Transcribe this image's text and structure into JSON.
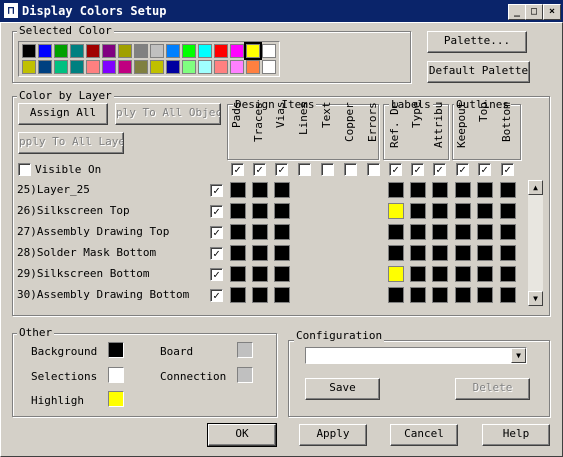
{
  "window": {
    "title": "Display Colors Setup",
    "buttons": [
      "_",
      "□",
      "×"
    ]
  },
  "selected_color": {
    "label": "Selected Color",
    "row1": [
      "#000000",
      "#0000ff",
      "#00a000",
      "#008080",
      "#a00000",
      "#800080",
      "#a0a000",
      "#808080",
      "#c0c0c0",
      "#0080ff",
      "#00ff00",
      "#00ffff",
      "#ff0000",
      "#ff00ff",
      "#ffff00",
      "#ffffff"
    ],
    "row2": [
      "#c0c000",
      "#004080",
      "#00c080",
      "#008080",
      "#ff8080",
      "#8000ff",
      "#c00080",
      "#808040",
      "#c0c000",
      "#0000a0",
      "#80ff80",
      "#a0ffff",
      "#ff8080",
      "#ff80ff",
      "#ff8040",
      "#ffffff"
    ],
    "selected_index": 14
  },
  "palette_button": "Palette...",
  "default_palette_button": "Default Palette",
  "color_by_layer": {
    "label": "Color by Layer",
    "assign_all": "Assign All",
    "apply_to_all_objects": "ply To All Objec",
    "apply_to_all_layers": "pply To All Layer",
    "design_items_label": "Design Items",
    "labels_label": "Labels",
    "outlines_label": "Outlines",
    "columns": [
      "Pads",
      "Traces",
      "Vias",
      "Lines",
      "Text",
      "Copper",
      "Errors",
      "Ref. De",
      "Type",
      "Attribu",
      "Keepout",
      "Top",
      "Bottom"
    ],
    "visible_on_label": "Visible On",
    "column_visible": [
      true,
      true,
      true,
      false,
      false,
      false,
      false,
      true,
      true,
      true,
      true,
      true,
      true
    ],
    "layers": [
      {
        "name": "25)Layer_25",
        "checked": true,
        "colors": [
          "#000000",
          "#000000",
          "#000000",
          "",
          "",
          "",
          "",
          "#000000",
          "#000000",
          "#000000",
          "#000000",
          "#000000",
          "#000000"
        ]
      },
      {
        "name": "26)Silkscreen Top",
        "checked": true,
        "colors": [
          "#000000",
          "#000000",
          "#000000",
          "",
          "",
          "",
          "",
          "#ffff00",
          "#000000",
          "#000000",
          "#000000",
          "#000000",
          "#000000"
        ]
      },
      {
        "name": "27)Assembly Drawing Top",
        "checked": true,
        "colors": [
          "#000000",
          "#000000",
          "#000000",
          "",
          "",
          "",
          "",
          "#000000",
          "#000000",
          "#000000",
          "#000000",
          "#000000",
          "#000000"
        ]
      },
      {
        "name": "28)Solder Mask Bottom",
        "checked": true,
        "colors": [
          "#000000",
          "#000000",
          "#000000",
          "",
          "",
          "",
          "",
          "#000000",
          "#000000",
          "#000000",
          "#000000",
          "#000000",
          "#000000"
        ]
      },
      {
        "name": "29)Silkscreen Bottom",
        "checked": true,
        "colors": [
          "#000000",
          "#000000",
          "#000000",
          "",
          "",
          "",
          "",
          "#ffff00",
          "#000000",
          "#000000",
          "#000000",
          "#000000",
          "#000000"
        ]
      },
      {
        "name": "30)Assembly Drawing Bottom",
        "checked": true,
        "colors": [
          "#000000",
          "#000000",
          "#000000",
          "",
          "",
          "",
          "",
          "#000000",
          "#000000",
          "#000000",
          "#000000",
          "#000000",
          "#000000"
        ]
      }
    ]
  },
  "other": {
    "label": "Other",
    "background": {
      "label": "Background",
      "color": "#000000"
    },
    "selections": {
      "label": "Selections",
      "color": "#ffffff"
    },
    "highlight": {
      "label": "Highligh",
      "color": "#ffff00"
    },
    "board": {
      "label": "Board",
      "color": "#c0c0c0"
    },
    "connection": {
      "label": "Connection",
      "color": "#c0c0c0"
    }
  },
  "configuration": {
    "label": "Configuration",
    "value": "",
    "save": "Save",
    "delete": "Delete"
  },
  "footer": {
    "ok": "OK",
    "apply": "Apply",
    "cancel": "Cancel",
    "help": "Help"
  }
}
